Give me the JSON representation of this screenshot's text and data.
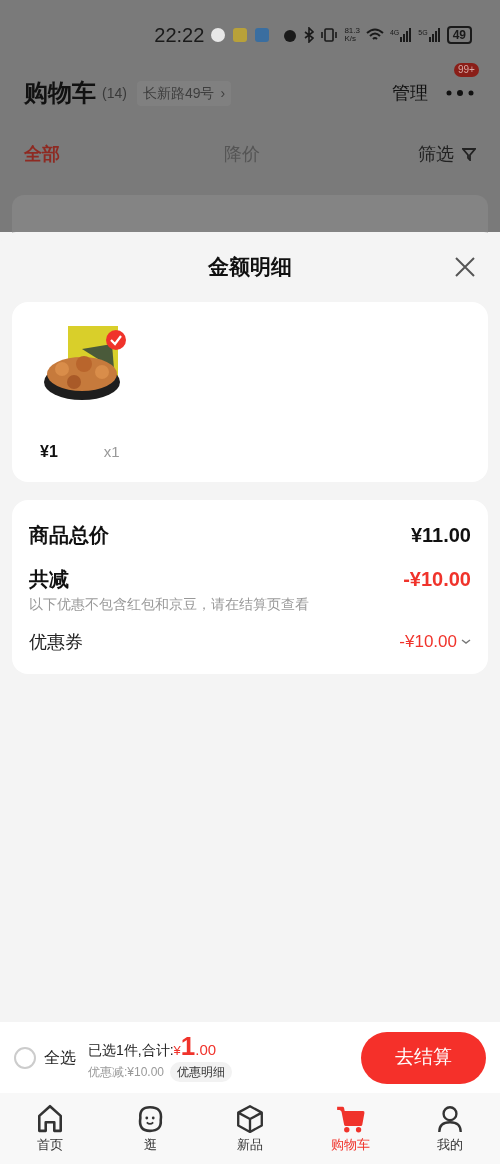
{
  "status_bar": {
    "time": "22:22",
    "speed_value": "81.3",
    "speed_unit": "K/s",
    "network_1": "4G",
    "network_2": "5G",
    "battery": "49"
  },
  "header": {
    "title": "购物车",
    "count": "(14)",
    "address": "长新路49号",
    "address_chevron": "›",
    "manage": "管理",
    "more_badge": "99+"
  },
  "filter_tabs": [
    {
      "label": "全部",
      "selected": true
    },
    {
      "label": "降价",
      "selected": false
    }
  ],
  "filter": {
    "label": "筛选"
  },
  "sheet": {
    "title": "金额明细",
    "products": [
      {
        "checked": true,
        "price": "¥1",
        "quantity": "x1"
      }
    ],
    "summary": [
      {
        "kind": "total",
        "label": "商品总价",
        "value": "¥11.00"
      },
      {
        "kind": "discount",
        "label": "共减",
        "value": "-¥10.00",
        "note": "以下优惠不包含红包和京豆，请在结算页查看"
      },
      {
        "kind": "coupon",
        "label": "优惠券",
        "value": "-¥10.00"
      }
    ]
  },
  "checkout": {
    "select_all": {
      "label": "全选",
      "checked": false
    },
    "selected_text": "已选1件,合计:",
    "currency": "¥",
    "amount_int": "1",
    "amount_dec": ".00",
    "discount_text": "优惠减:¥10.00",
    "detail_button": "优惠明细",
    "checkout_button": "去结算"
  },
  "tab_bar": [
    {
      "kind": "home",
      "label": "首页",
      "selected": false
    },
    {
      "kind": "face",
      "label": "逛",
      "selected": false
    },
    {
      "kind": "box",
      "label": "新品",
      "selected": false
    },
    {
      "kind": "cart",
      "label": "购物车",
      "selected": true
    },
    {
      "kind": "person",
      "label": "我的",
      "selected": false
    }
  ]
}
